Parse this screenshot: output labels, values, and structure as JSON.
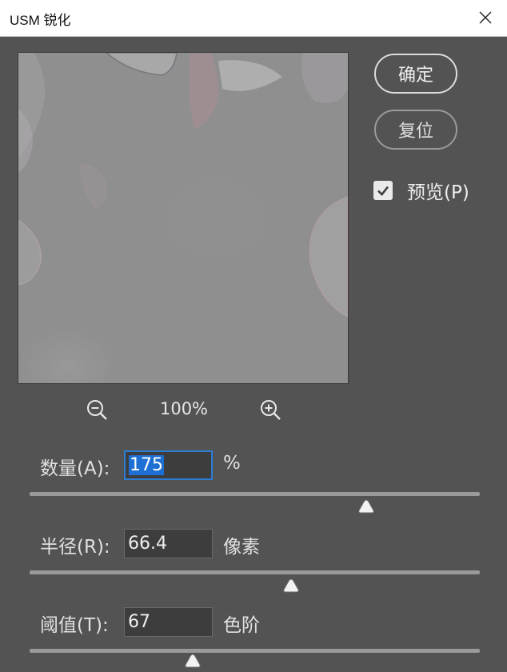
{
  "window": {
    "title": "USM 锐化"
  },
  "preview_zoom": {
    "value": "100%"
  },
  "buttons": {
    "ok_label": "确定",
    "reset_label": "复位"
  },
  "preview_checkbox": {
    "label": "预览(P)",
    "checked": true
  },
  "params": {
    "amount": {
      "label": "数量(A):",
      "value": "175",
      "unit": "%",
      "slider_fraction": 0.747
    },
    "radius": {
      "label": "半径(R):",
      "value": "66.4",
      "unit": "像素",
      "slider_fraction": 0.58
    },
    "threshold": {
      "label": "阈值(T):",
      "value": "67",
      "unit": "色阶",
      "slider_fraction": 0.363
    }
  },
  "colors": {
    "background": "#535353",
    "accent": "#1d6fd3"
  }
}
